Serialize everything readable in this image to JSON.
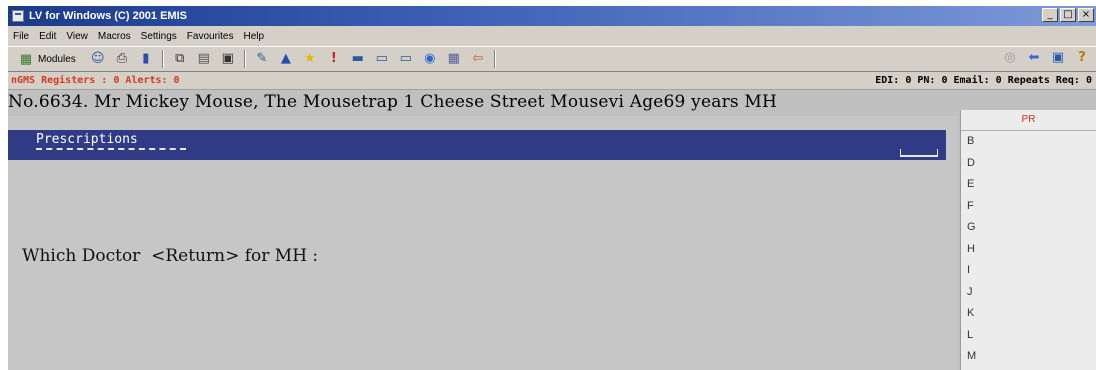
{
  "window": {
    "title": "LV for Windows (C) 2001 EMIS",
    "buttons": [
      "_",
      "□",
      "×"
    ]
  },
  "menu": [
    "File",
    "Edit",
    "View",
    "Macros",
    "Settings",
    "Favourites",
    "Help"
  ],
  "toolbar": {
    "modules_label": "Modules",
    "icons": [
      "modules-icon",
      "people-icon",
      "printer-icon",
      "book-icon",
      "copy-icon",
      "paste-icon",
      "clipboard-icon",
      "tools-icon",
      "flask-icon",
      "star-icon",
      "alert-icon",
      "nhs-icon",
      "card-icon",
      "screen-icon",
      "globe-icon",
      "calendar-icon",
      "arrow-icon",
      "disc-icon",
      "back-arrow-icon",
      "help-icon"
    ]
  },
  "status": {
    "ngms": "nGMS Registers : 0  Alerts: 0",
    "edi": "EDI: 0  PN: 0  Email: 0  Repeats Req: 0"
  },
  "patient_line": "No.6634. Mr Mickey Mouse, The Mousetrap 1 Cheese Street Mousevi  Age69 years MH",
  "panel": {
    "title": "Prescriptions"
  },
  "prompt": "Which Doctor  <Return> for MH :",
  "side": {
    "header": "PR",
    "letters": [
      "B",
      "D",
      "E",
      "F",
      "G",
      "H",
      "I",
      "J",
      "K",
      "L",
      "M"
    ]
  },
  "colors": {
    "banner": "#2f3c85",
    "alert_text": "#d23b1e",
    "titlebar": "#1b3a8a"
  }
}
